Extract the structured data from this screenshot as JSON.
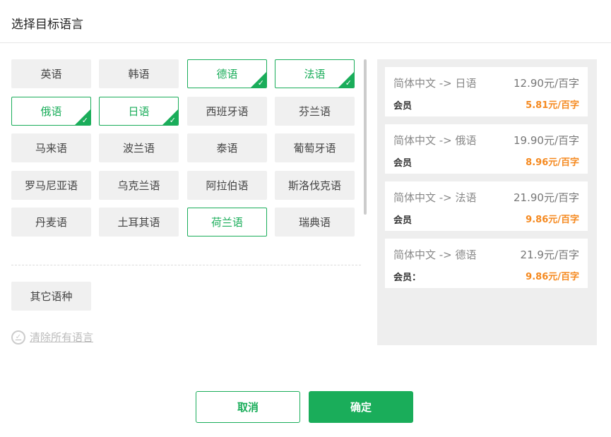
{
  "dialog": {
    "title": "选择目标语言"
  },
  "languages": [
    {
      "label": "英语",
      "state": "normal"
    },
    {
      "label": "韩语",
      "state": "normal"
    },
    {
      "label": "德语",
      "state": "selected"
    },
    {
      "label": "法语",
      "state": "selected"
    },
    {
      "label": "俄语",
      "state": "selected"
    },
    {
      "label": "日语",
      "state": "selected"
    },
    {
      "label": "西班牙语",
      "state": "normal"
    },
    {
      "label": "芬兰语",
      "state": "normal"
    },
    {
      "label": "马来语",
      "state": "normal"
    },
    {
      "label": "波兰语",
      "state": "normal"
    },
    {
      "label": "泰语",
      "state": "normal"
    },
    {
      "label": "葡萄牙语",
      "state": "normal"
    },
    {
      "label": "罗马尼亚语",
      "state": "normal"
    },
    {
      "label": "乌克兰语",
      "state": "normal"
    },
    {
      "label": "阿拉伯语",
      "state": "normal"
    },
    {
      "label": "斯洛伐克语",
      "state": "normal"
    },
    {
      "label": "丹麦语",
      "state": "normal"
    },
    {
      "label": "土耳其语",
      "state": "normal"
    },
    {
      "label": "荷兰语",
      "state": "highlight"
    },
    {
      "label": "瑞典语",
      "state": "normal"
    }
  ],
  "other_languages_label": "其它语种",
  "clear_all_label": "清除所有语言",
  "prices": [
    {
      "route": "简体中文 -> 日语",
      "normal_price": "12.90元/百字",
      "member_label": "会员",
      "member_price": "5.81元/百字"
    },
    {
      "route": "简体中文 -> 俄语",
      "normal_price": "19.90元/百字",
      "member_label": "会员",
      "member_price": "8.96元/百字"
    },
    {
      "route": "简体中文 -> 法语",
      "normal_price": "21.90元/百字",
      "member_label": "会员",
      "member_price": "9.86元/百字"
    },
    {
      "route": "简体中文 -> 德语",
      "normal_price": "21.9元/百字",
      "member_label": "会员：",
      "member_price": "9.86元/百字"
    }
  ],
  "actions": {
    "cancel_label": "取消",
    "confirm_label": "确定"
  },
  "colors": {
    "accent": "#1aad5a",
    "member_price": "#f5891f"
  }
}
